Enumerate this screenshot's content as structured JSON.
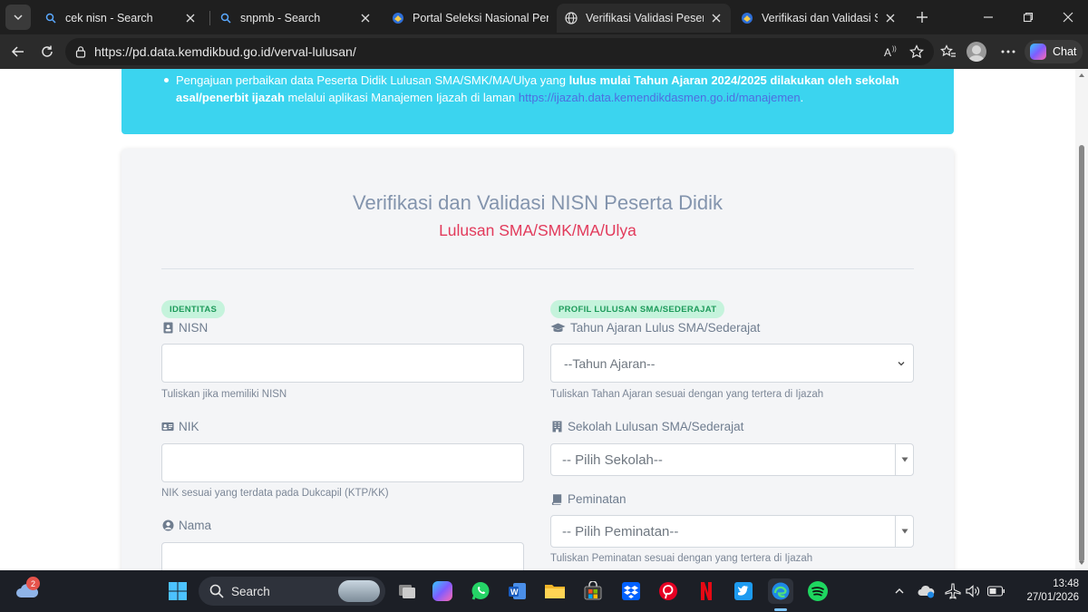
{
  "browser": {
    "tabs": [
      {
        "title": "cek nisn - Search",
        "favicon": "bing-search-icon",
        "active": false
      },
      {
        "title": "snpmb - Search",
        "favicon": "bing-search-icon",
        "active": false
      },
      {
        "title": "Portal Seleksi Nasional Pene",
        "favicon": "snpmb-logo-icon",
        "active": false
      },
      {
        "title": "Verifikasi Validasi Peserta Di",
        "favicon": "globe-icon",
        "active": true
      },
      {
        "title": "Verifikasi dan Validasi SNPM",
        "favicon": "snpmb-logo-icon",
        "active": false
      }
    ],
    "url": "https://pd.data.kemdikbud.go.id/verval-lulusan/",
    "chat_label": "Chat"
  },
  "page": {
    "alert": {
      "line1_pre": "Pengajuan perbaikan data Peserta Didik Lulusan SMA/SMK/MA/Ulya yang ",
      "line1_bold": "lulus mulai Tahun Ajaran 2024/2025 dilakukan oleh sekolah",
      "line2_bold": "asal/penerbit ijazah",
      "line2_mid": " melalui aplikasi Manajemen Ijazah di laman ",
      "line2_link": "https://ijazah.data.kemendikdasmen.go.id/manajemen",
      "line2_end": "."
    },
    "title": "Verifikasi dan Validasi NISN Peserta Didik",
    "subtitle": "Lulusan SMA/SMK/MA/Ulya",
    "left": {
      "badge": "IDENTITAS",
      "nisn_label": "NISN",
      "nisn_value": "",
      "nisn_help": "Tuliskan jika memiliki NISN",
      "nik_label": "NIK",
      "nik_value": "",
      "nik_help": "NIK sesuai yang terdata pada Dukcapil (KTP/KK)",
      "nama_label": "Nama",
      "nama_value": ""
    },
    "right": {
      "badge": "PROFIL LULUSAN SMA/SEDERAJAT",
      "tahun_label": "Tahun Ajaran Lulus SMA/Sederajat",
      "tahun_selected": "--Tahun Ajaran--",
      "tahun_help": "Tuliskan Tahan Ajaran sesuai dengan yang tertera di Ijazah",
      "sekolah_label": "Sekolah Lulusan SMA/Sederajat",
      "sekolah_selected": "-- Pilih Sekolah--",
      "peminatan_label": "Peminatan",
      "peminatan_selected": "-- Pilih Peminatan--",
      "peminatan_help": "Tuliskan Peminatan sesuai dengan yang tertera di Ijazah"
    }
  },
  "taskbar": {
    "weather_badge": "2",
    "search_label": "Search",
    "time": "13:48",
    "date": "27/01/2026"
  }
}
